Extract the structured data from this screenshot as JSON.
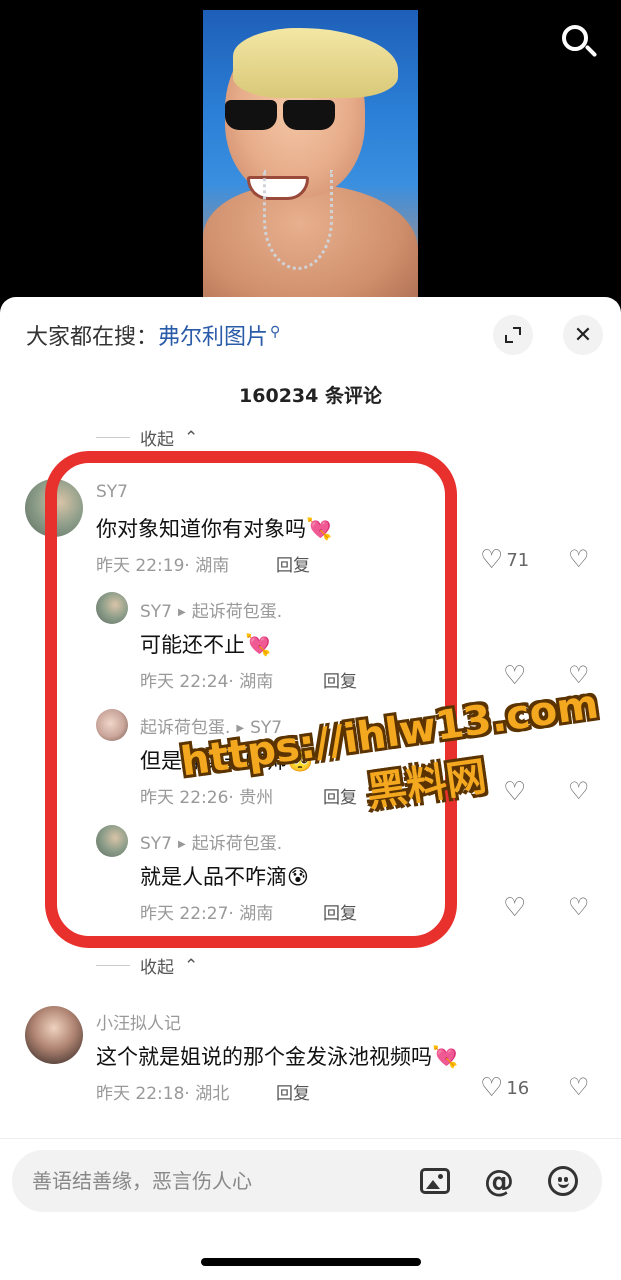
{
  "header": {
    "search_prefix": "大家都在搜：",
    "search_keyword": "弗尔利图片",
    "search_keyword_icon": "search-small-icon"
  },
  "comment_count": "160234 条评论",
  "collapse_label": "收起",
  "comments": [
    {
      "user": "SY7",
      "text": "你对象知道你有对象吗",
      "emoji": "💘",
      "time": "昨天 22:19",
      "location": "· 湖南",
      "reply": "回复",
      "likes": "71",
      "replies": [
        {
          "user": "SY7",
          "reply_to": "起诉荷包蛋.",
          "text": "可能还不止",
          "emoji": "💘",
          "time": "昨天 22:24",
          "location": "· 湖南",
          "reply": "回复"
        },
        {
          "user": "起诉荷包蛋.",
          "reply_to": "SY7",
          "text": "但是确实长的帅",
          "emoji": "🥺",
          "time": "昨天 22:26",
          "location": "· 贵州",
          "reply": "回复"
        },
        {
          "user": "SY7",
          "reply_to": "起诉荷包蛋.",
          "text": "就是人品不咋滴",
          "emoji": "😰",
          "time": "昨天 22:27",
          "location": "· 湖南",
          "reply": "回复"
        }
      ]
    },
    {
      "user": "小汪拟人记",
      "text": "这个就是姐说的那个金发泳池视频吗",
      "emoji": "💘",
      "time": "昨天 22:18",
      "location": "· 湖北",
      "reply": "回复",
      "likes": "16"
    }
  ],
  "watermark": {
    "url": "https://ihlw13.com",
    "text": "黑料网"
  },
  "input": {
    "placeholder": "善语结善缘，恶言伤人心",
    "value": ""
  },
  "colors": {
    "highlight": "#e8302d",
    "keyword": "#2a5ba8",
    "watermark": "#f3a81f"
  }
}
